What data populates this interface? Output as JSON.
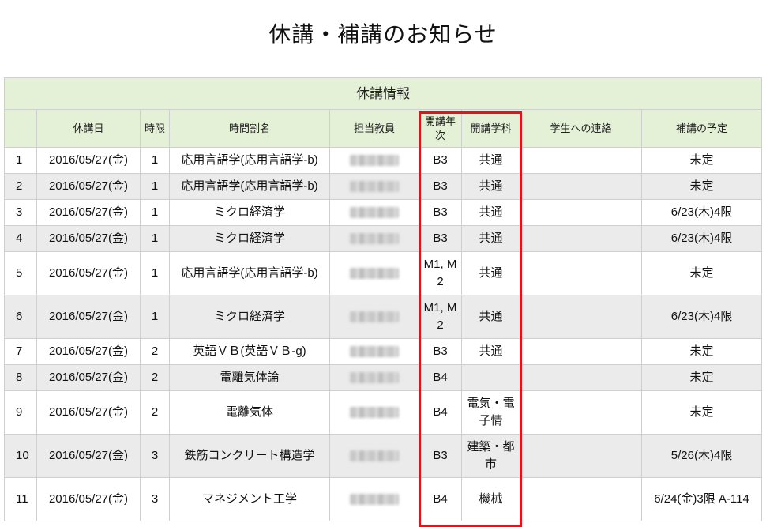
{
  "page": {
    "title": "休講・補講のお知らせ"
  },
  "table": {
    "caption": "休講情報",
    "columns": [
      "",
      "休講日",
      "時限",
      "時間割名",
      "担当教員",
      "開講年次",
      "開講学科",
      "学生への連絡",
      "補講の予定"
    ],
    "rows": [
      {
        "no": "1",
        "date": "2016/05/27(金)",
        "period": "1",
        "course": "応用言語学(応用言語学-b)",
        "year": "B3",
        "dept": "共通",
        "contact": "",
        "makeup": "未定"
      },
      {
        "no": "2",
        "date": "2016/05/27(金)",
        "period": "1",
        "course": "応用言語学(応用言語学-b)",
        "year": "B3",
        "dept": "共通",
        "contact": "",
        "makeup": "未定"
      },
      {
        "no": "3",
        "date": "2016/05/27(金)",
        "period": "1",
        "course": "ミクロ経済学",
        "year": "B3",
        "dept": "共通",
        "contact": "",
        "makeup": "6/23(木)4限"
      },
      {
        "no": "4",
        "date": "2016/05/27(金)",
        "period": "1",
        "course": "ミクロ経済学",
        "year": "B3",
        "dept": "共通",
        "contact": "",
        "makeup": "6/23(木)4限"
      },
      {
        "no": "5",
        "date": "2016/05/27(金)",
        "period": "1",
        "course": "応用言語学(応用言語学-b)",
        "year": "M1, M2",
        "dept": "共通",
        "contact": "",
        "makeup": "未定"
      },
      {
        "no": "6",
        "date": "2016/05/27(金)",
        "period": "1",
        "course": "ミクロ経済学",
        "year": "M1, M2",
        "dept": "共通",
        "contact": "",
        "makeup": "6/23(木)4限"
      },
      {
        "no": "7",
        "date": "2016/05/27(金)",
        "period": "2",
        "course": "英語ＶＢ(英語ＶＢ-g)",
        "year": "B3",
        "dept": "共通",
        "contact": "",
        "makeup": "未定"
      },
      {
        "no": "8",
        "date": "2016/05/27(金)",
        "period": "2",
        "course": "電離気体論",
        "year": "B4",
        "dept": "",
        "contact": "",
        "makeup": "未定"
      },
      {
        "no": "9",
        "date": "2016/05/27(金)",
        "period": "2",
        "course": "電離気体",
        "year": "B4",
        "dept": "電気・電子情",
        "contact": "",
        "makeup": "未定"
      },
      {
        "no": "10",
        "date": "2016/05/27(金)",
        "period": "3",
        "course": "鉄筋コンクリート構造学",
        "year": "B3",
        "dept": "建築・都市",
        "contact": "",
        "makeup": "5/26(木)4限"
      },
      {
        "no": "11",
        "date": "2016/05/27(金)",
        "period": "3",
        "course": "マネジメント工学",
        "year": "B4",
        "dept": "機械",
        "contact": "",
        "makeup": "6/24(金)3限 A-114"
      }
    ]
  },
  "colors": {
    "header_bg": "#e4f1d6",
    "highlight_box": "#e0141b",
    "row_alt": "#ebebeb"
  }
}
